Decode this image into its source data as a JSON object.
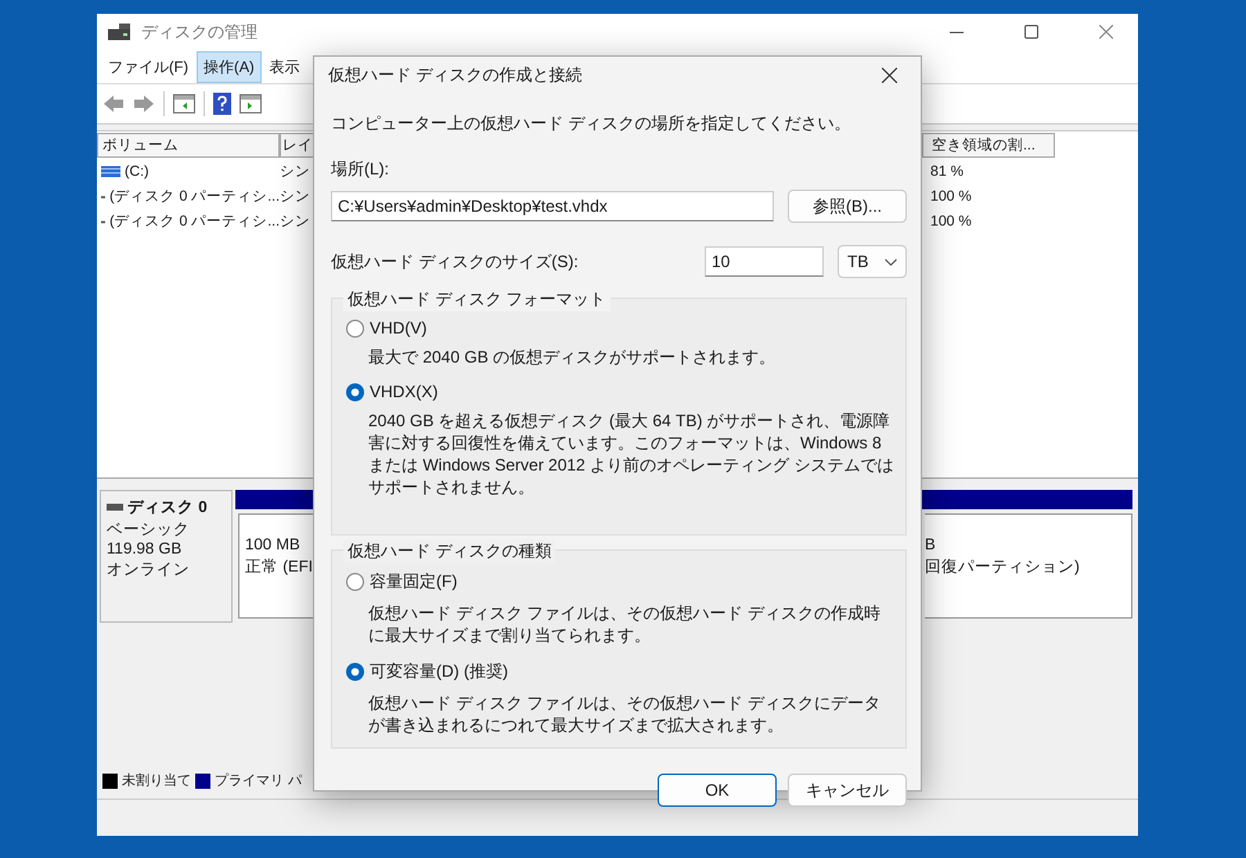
{
  "background_window": {
    "title": "ディスクの管理",
    "menu": [
      {
        "label": "ファイル(F)",
        "selected": false
      },
      {
        "label": "操作(A)",
        "selected": true
      },
      {
        "label": "表示",
        "selected": false
      }
    ],
    "volume_list": {
      "columns": [
        "ボリューム",
        "レイ",
        "空き領域の割..."
      ],
      "rows": [
        {
          "kind": "system",
          "volume": "(C:)",
          "layout": "シン",
          "free_percent": "81 %"
        },
        {
          "kind": "partition",
          "volume": "(ディスク 0 パーティシ...",
          "layout": "シン",
          "free_percent": "100 %"
        },
        {
          "kind": "partition",
          "volume": "(ディスク 0 パーティシ...",
          "layout": "シン",
          "free_percent": "100 %"
        }
      ]
    },
    "disks": [
      {
        "name": "ディスク 0",
        "type": "ベーシック",
        "size": "119.98 GB",
        "status": "オンライン",
        "partitions": [
          {
            "size": "100 MB",
            "status": "正常 (EFI"
          },
          {
            "size": "B",
            "status": "回復パーティション)"
          }
        ]
      }
    ],
    "legend": [
      {
        "label": "未割り当て",
        "color": "#000000"
      },
      {
        "label": "プライマリ パ",
        "color": "#00008b"
      }
    ]
  },
  "dialog": {
    "title": "仮想ハード ディスクの作成と接続",
    "instruction": "コンピューター上の仮想ハード ディスクの場所を指定してください。",
    "location_label": "場所(L):",
    "location_value": "C:¥Users¥admin¥Desktop¥test.vhdx",
    "browse_button": "参照(B)...",
    "size_label": "仮想ハード ディスクのサイズ(S):",
    "size_value": "10",
    "size_unit": "TB",
    "groups": [
      {
        "title": "仮想ハード ディスク フォーマット",
        "options": [
          {
            "label": "VHD(V)",
            "selected": false,
            "description": "最大で 2040 GB の仮想ディスクがサポートされます。"
          },
          {
            "label": "VHDX(X)",
            "selected": true,
            "description": "2040 GB を超える仮想ディスク (最大 64 TB) がサポートされ、電源障害に対する回復性を備えています。このフォーマットは、Windows 8 または Windows Server 2012 より前のオペレーティング システムではサポートされません。"
          }
        ]
      },
      {
        "title": "仮想ハード ディスクの種類",
        "options": [
          {
            "label": "容量固定(F)",
            "selected": false,
            "description": "仮想ハード ディスク ファイルは、その仮想ハード ディスクの作成時に最大サイズまで割り当てられます。"
          },
          {
            "label": "可変容量(D) (推奨)",
            "selected": true,
            "description": "仮想ハード ディスク ファイルは、その仮想ハード ディスクにデータが書き込まれるにつれて最大サイズまで拡大されます。"
          }
        ]
      }
    ],
    "buttons": [
      {
        "label": "OK",
        "kind": "default"
      },
      {
        "label": "キャンセル",
        "kind": "normal"
      }
    ]
  }
}
